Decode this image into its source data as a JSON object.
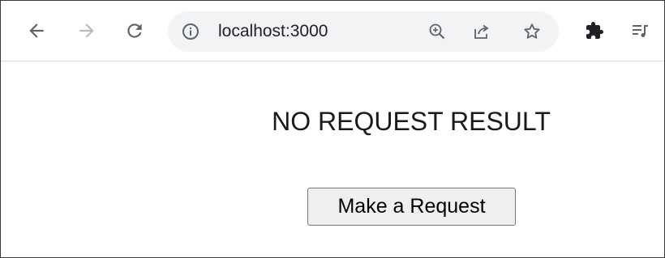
{
  "browser": {
    "address_bar": {
      "url": "localhost:3000"
    },
    "icons": {
      "back": "arrow-left-icon",
      "forward": "arrow-right-icon",
      "reload": "reload-icon",
      "site_info": "info-circle-icon",
      "zoom": "zoom-in-icon",
      "share": "share-icon",
      "bookmark": "star-icon",
      "extensions": "puzzle-icon",
      "media": "media-queue-icon"
    },
    "colors": {
      "icon": "#5f6368",
      "icon_disabled": "#b8bcc0",
      "omnibox_bg": "#f1f3f4"
    }
  },
  "page": {
    "result_text": "NO REQUEST RESULT",
    "request_button_label": "Make a Request"
  }
}
